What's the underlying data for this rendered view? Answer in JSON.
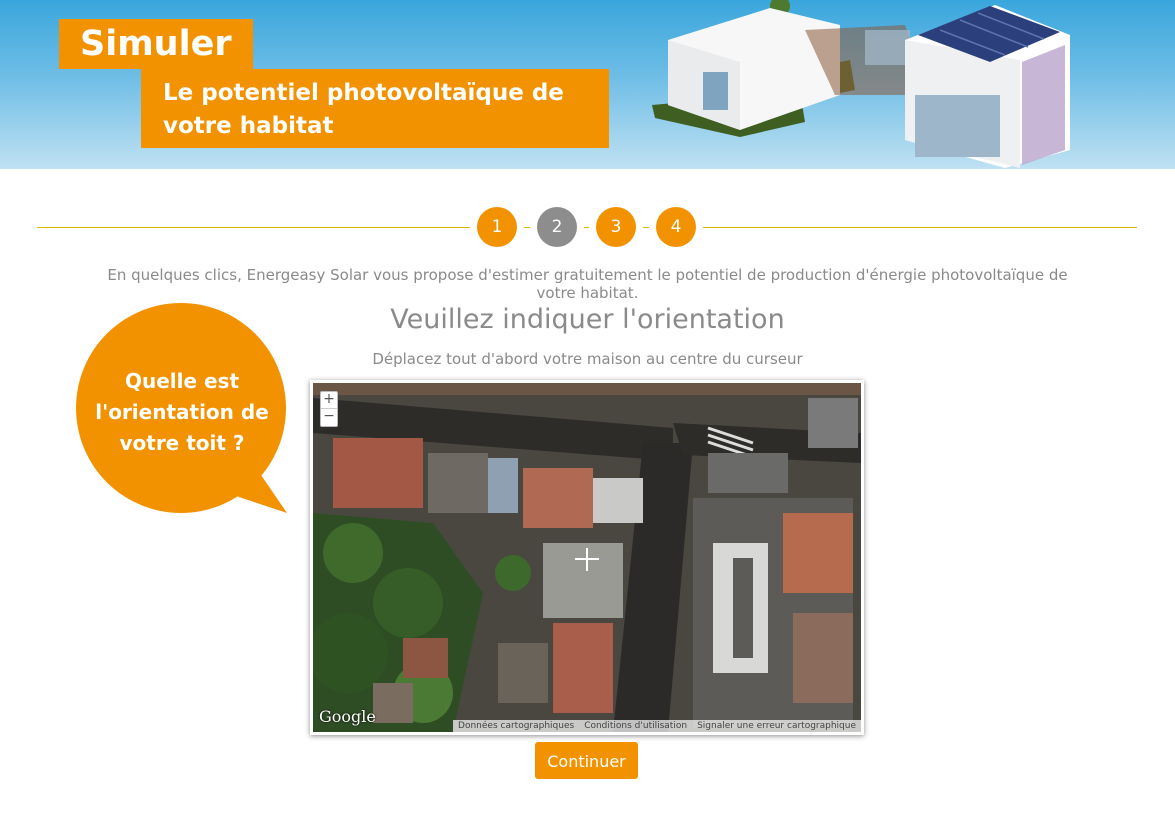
{
  "header": {
    "title": "Simuler",
    "subtitle": "Le potentiel photovoltaïque de votre habitat"
  },
  "steps": [
    {
      "label": "1",
      "active": false
    },
    {
      "label": "2",
      "active": true
    },
    {
      "label": "3",
      "active": false
    },
    {
      "label": "4",
      "active": false
    }
  ],
  "intro": "En quelques clics, Energeasy Solar vous propose d'estimer gratuitement le potentiel de production d'énergie photovoltaïque de votre habitat.",
  "heading": "Veuillez indiquer l'orientation",
  "instruction": "Déplacez tout d'abord votre maison au centre du curseur",
  "bubble": {
    "line1": "Quelle est",
    "line2": "l'orientation de",
    "line3": "votre toit ?"
  },
  "map": {
    "zoom_in": "+",
    "zoom_out": "−",
    "logo": "Google",
    "footer_data": "Données cartographiques",
    "footer_terms": "Conditions d'utilisation",
    "footer_report": "Signaler une erreur cartographique"
  },
  "continue_label": "Continuer",
  "colors": {
    "accent": "#f39200",
    "step_active": "#8d8d8d",
    "text_grey": "#8a8a8a",
    "divider": "#e0b500"
  }
}
